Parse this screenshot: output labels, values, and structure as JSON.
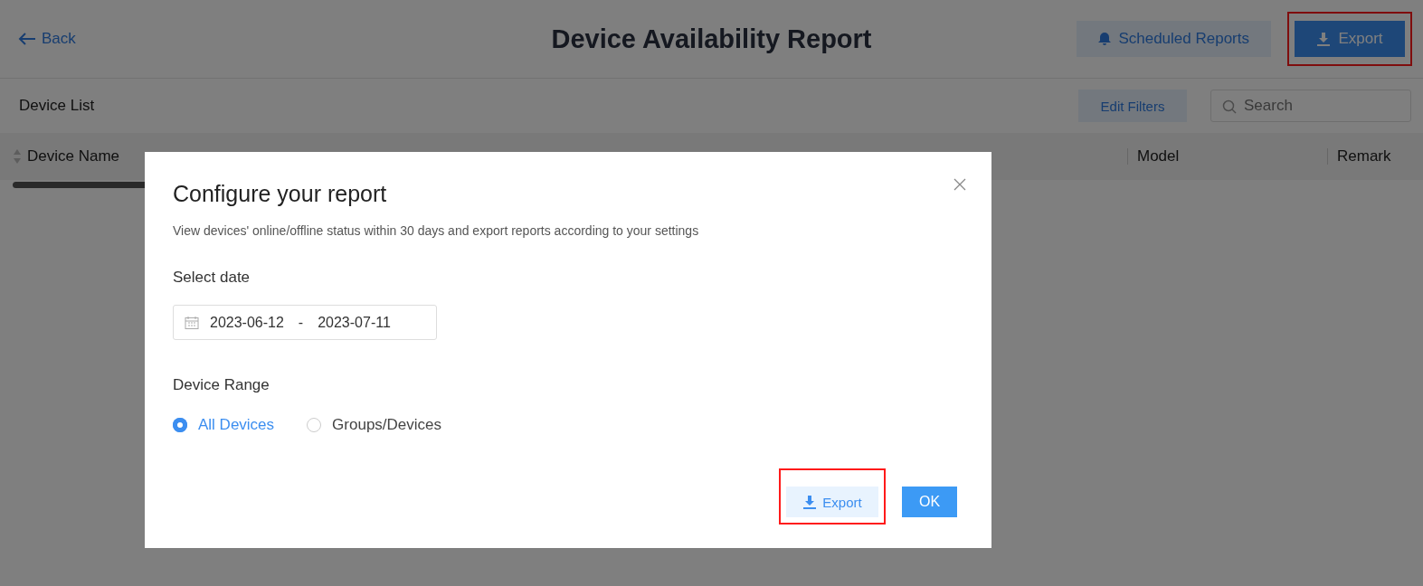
{
  "header": {
    "back": "Back",
    "title": "Device Availability Report",
    "buttons": [
      {
        "kind": "scheduled",
        "label": "Scheduled Reports",
        "highlighted": false
      },
      {
        "kind": "export",
        "label": "Export",
        "highlighted": true
      }
    ]
  },
  "toolbar": {
    "title": "Device List",
    "filter_button": "Edit Filters",
    "search": {
      "placeholder": "Search"
    }
  },
  "table": {
    "columns": [
      {
        "label": "Device Name",
        "sortable": true
      },
      {
        "label": "Model",
        "sortable": false
      },
      {
        "label": "Remark",
        "sortable": false
      }
    ]
  },
  "dialog": {
    "title": "Configure your report",
    "description": "View devices' online/offline status within 30 days and export reports according to your settings",
    "date_label": "Select date",
    "date_start": "2023-06-12",
    "date_separator": "-",
    "date_end": "2023-07-11",
    "range_label": "Device Range",
    "options": [
      {
        "label": "All Devices",
        "selected": true
      },
      {
        "label": "Groups/Devices",
        "selected": false
      }
    ],
    "buttons": [
      {
        "kind": "export",
        "label": "Export",
        "highlighted": true
      },
      {
        "kind": "ok",
        "label": "OK",
        "highlighted": false
      }
    ]
  }
}
